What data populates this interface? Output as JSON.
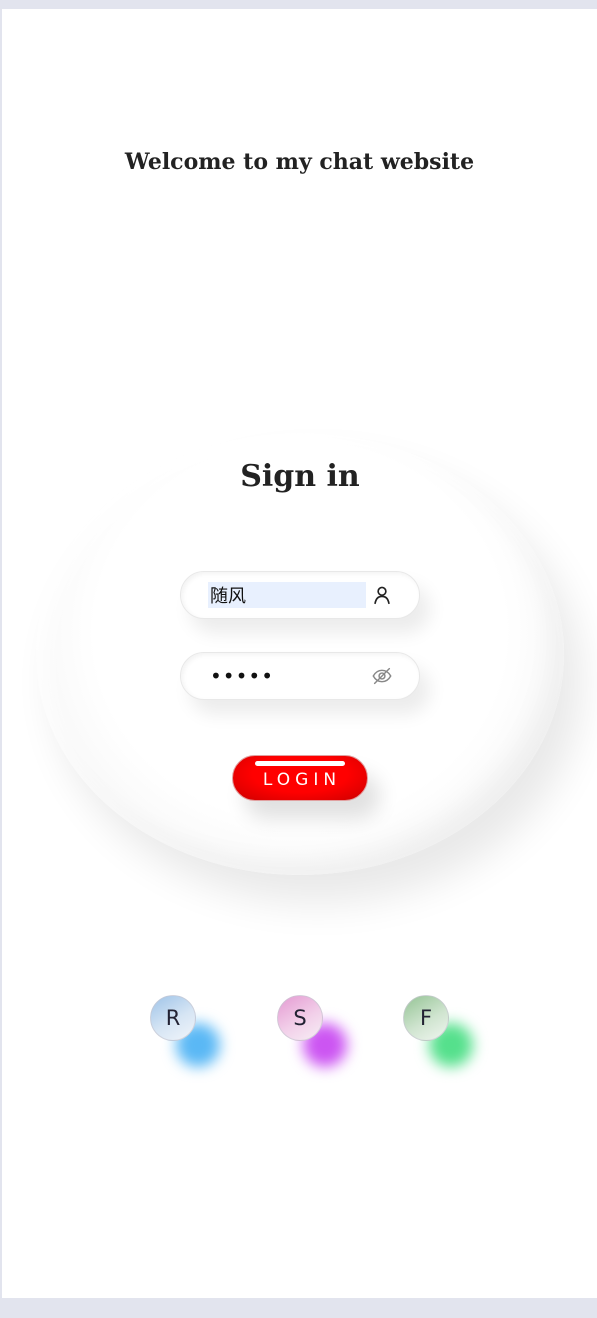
{
  "header": {
    "welcome_text": "Welcome to my chat website"
  },
  "login_form": {
    "title": "Sign in",
    "username": {
      "value": "随风",
      "icon": "user-icon"
    },
    "password": {
      "value": "•••••",
      "icon": "eye-off-icon"
    },
    "login_button_label": "LOGIN",
    "login_button_color": "#ff0000"
  },
  "circles": [
    {
      "label": "R",
      "glow_color": "#5ab8f5"
    },
    {
      "label": "S",
      "glow_color": "#cc55f2"
    },
    {
      "label": "F",
      "glow_color": "#55e08c"
    }
  ]
}
